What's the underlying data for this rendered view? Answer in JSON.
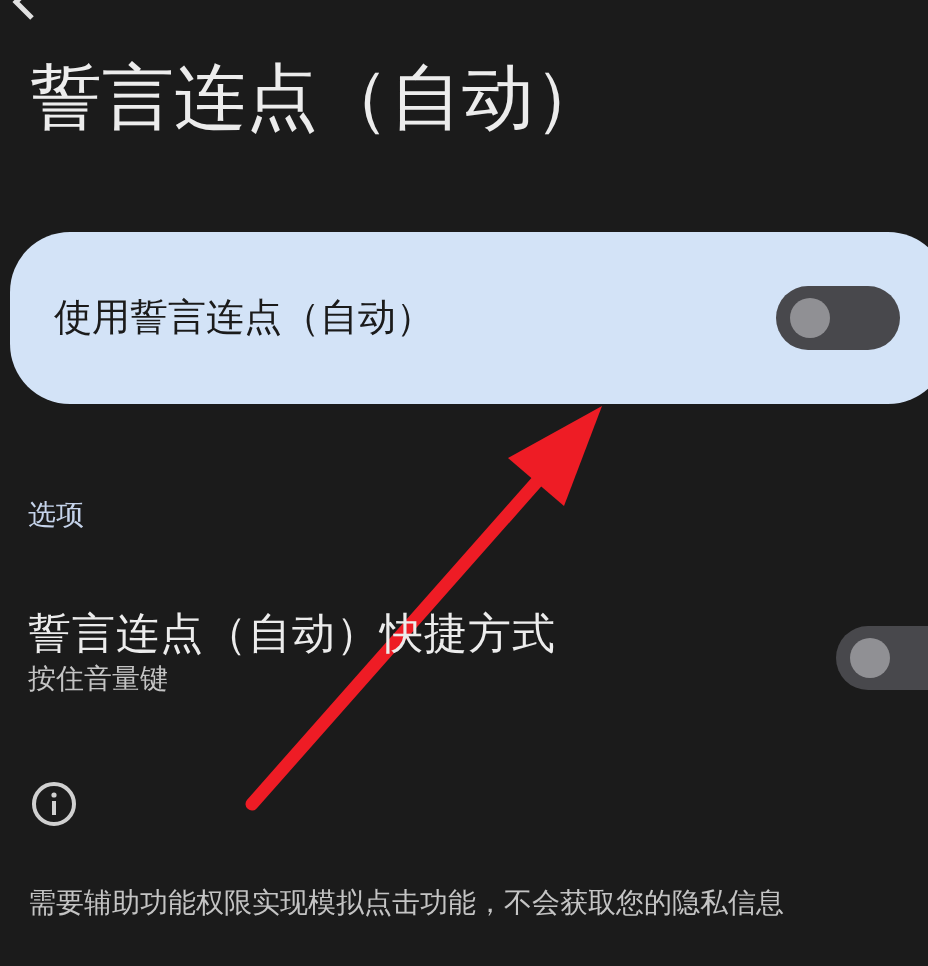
{
  "title": "誓言连点（自动）",
  "main_switch": {
    "label": "使用誓言连点（自动）",
    "on": false
  },
  "section_header": "选项",
  "options": [
    {
      "title": "誓言连点（自动）快捷方式",
      "summary": "按住音量键",
      "on": false
    }
  ],
  "footer": "需要辅助功能权限实现模拟点击功能，不会获取您的隐私信息"
}
